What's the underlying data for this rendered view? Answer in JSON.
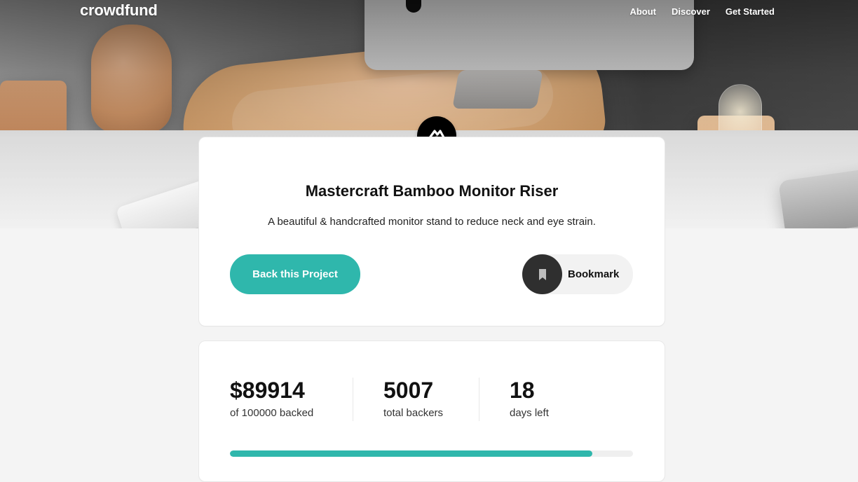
{
  "header": {
    "logo_text": "crowdfund",
    "nav": [
      {
        "label": "About"
      },
      {
        "label": "Discover"
      },
      {
        "label": "Get Started"
      }
    ]
  },
  "project": {
    "title": "Mastercraft Bamboo Monitor Riser",
    "subtitle": "A beautiful & handcrafted monitor stand to reduce neck and eye strain.",
    "back_button_label": "Back this Project",
    "bookmark_label": "Bookmark"
  },
  "stats": {
    "backed_value": "$89914",
    "backed_label": "of 100000 backed",
    "backers_value": "5007",
    "backers_label": "total backers",
    "days_value": "18",
    "days_label": "days left",
    "progress_fraction": 0.89914
  },
  "colors": {
    "accent": "#2fb7ac",
    "dark": "#2f2f2f",
    "background": "#f4f4f4"
  },
  "icons": {
    "project_logo": "mastercraft-logo-icon",
    "bookmark": "bookmark-icon"
  }
}
